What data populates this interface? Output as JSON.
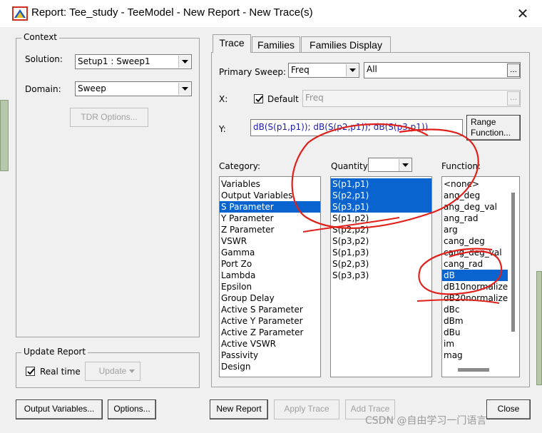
{
  "window": {
    "title": "Report: Tee_study - TeeModel - New Report - New Trace(s)",
    "close_glyph": "✕"
  },
  "context": {
    "legend": "Context",
    "solution_label": "Solution:",
    "solution_value": "Setup1 : Sweep1",
    "domain_label": "Domain:",
    "domain_value": "Sweep",
    "tdr_button": "TDR Options..."
  },
  "update_report": {
    "legend": "Update Report",
    "realtime_label": "Real time",
    "realtime_checked": true,
    "update_button": "Update"
  },
  "tabs": [
    {
      "label": "Trace",
      "active": true
    },
    {
      "label": "Families"
    },
    {
      "label": "Families Display"
    }
  ],
  "trace": {
    "primary_sweep_label": "Primary Sweep:",
    "primary_sweep_value": "Freq",
    "sweep_range_value": "All",
    "ellipsis": "...",
    "x_label": "X:",
    "default_label": "Default",
    "default_checked": true,
    "x_value": "Freq",
    "y_label": "Y:",
    "y_value": "dB(S(p1,p1)); dB(S(p2,p1)); dB(S(p3,p1))",
    "range_function_button_line1": "Range",
    "range_function_button_line2": "Function...",
    "category_label": "Category:",
    "quantity_label": "Quantity:",
    "function_label": "Function:",
    "categories": [
      "Variables",
      "Output Variables",
      "S Parameter",
      "Y Parameter",
      "Z Parameter",
      "VSWR",
      "Gamma",
      "Port Zo",
      "Lambda",
      "Epsilon",
      "Group Delay",
      "Active S Parameter",
      "Active Y Parameter",
      "Active Z Parameter",
      "Active VSWR",
      "Passivity",
      "Design"
    ],
    "quantities": [
      "S(p1,p1)",
      "S(p2,p1)",
      "S(p3,p1)",
      "S(p1,p2)",
      "S(p2,p2)",
      "S(p3,p2)",
      "S(p1,p3)",
      "S(p2,p3)",
      "S(p3,p3)"
    ],
    "functions": [
      "<none>",
      "ang_deg",
      "ang_deg_val",
      "ang_rad",
      "arg",
      "cang_deg",
      "cang_deg_val",
      "cang_rad",
      "dB",
      "dB10normalize",
      "dB20normalize",
      "dBc",
      "dBm",
      "dBu",
      "im",
      "mag"
    ]
  },
  "bottom": {
    "output_variables_button": "Output Variables...",
    "options_button": "Options...",
    "new_report_button": "New Report",
    "apply_trace_button": "Apply Trace",
    "add_trace_button": "Add Trace",
    "close_button": "Close"
  },
  "watermark": "CSDN @自由学习一门语言",
  "colors": {
    "selection": "#0a64d0",
    "annotation": "#e0201a",
    "y_text": "#1a1ab0"
  }
}
